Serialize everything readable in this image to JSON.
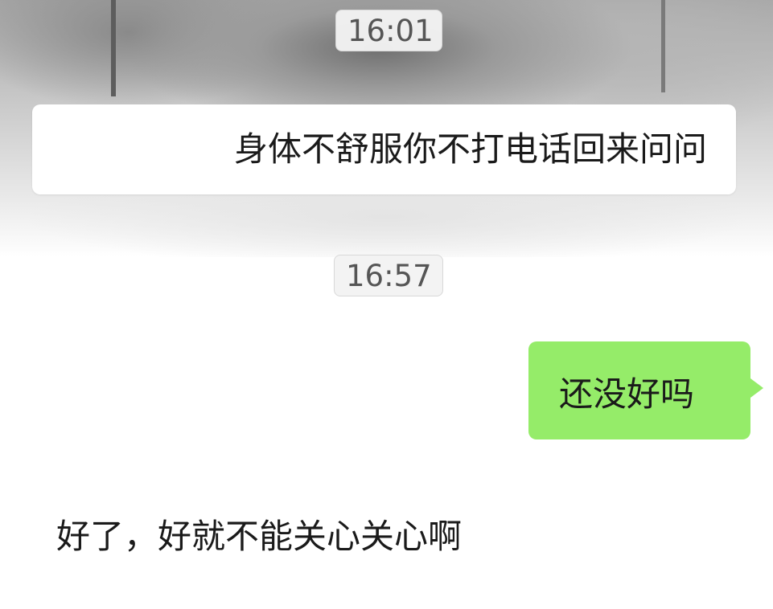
{
  "messages": [
    {
      "type": "timestamp",
      "text": "16:01"
    },
    {
      "type": "received",
      "text": "身体不舒服你不打电话回来问问"
    },
    {
      "type": "timestamp",
      "text": "16:57"
    },
    {
      "type": "sent",
      "text": "还没好吗"
    },
    {
      "type": "received",
      "text": "好了，好就不能关心关心啊"
    }
  ],
  "colors": {
    "sent_bubble": "#95ec69",
    "received_bubble": "#ffffff",
    "timestamp_bg": "#f2f2f2"
  }
}
